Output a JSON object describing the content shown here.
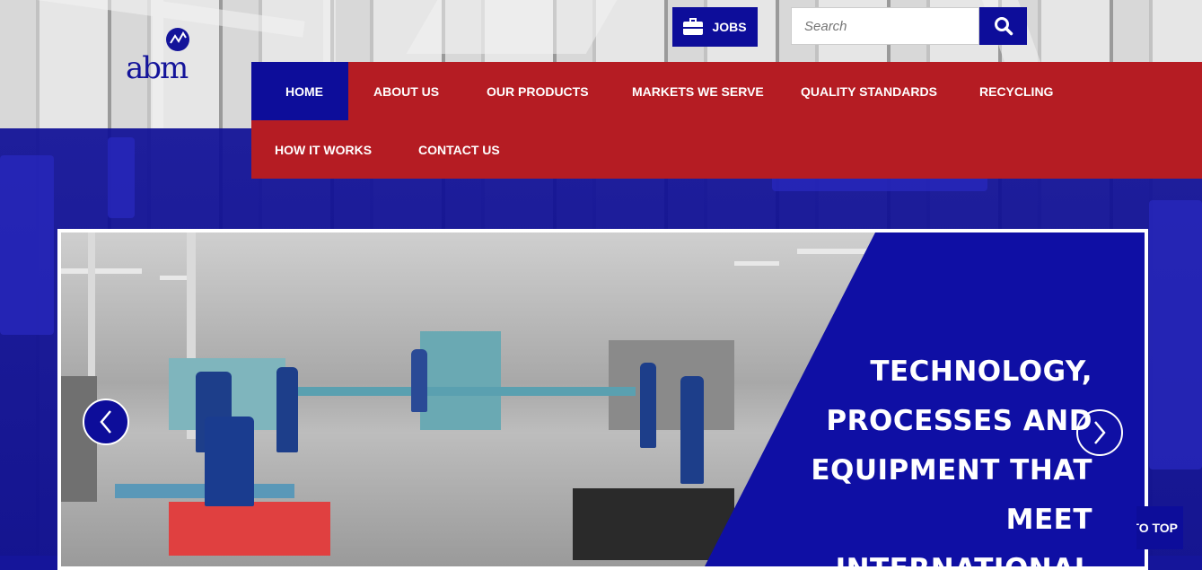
{
  "brand": {
    "logo_text": "abm",
    "colors": {
      "blue": "#0d0d9a",
      "red": "#b51c23",
      "white": "#ffffff"
    }
  },
  "header": {
    "jobs_label": "JOBS",
    "jobs_icon": "briefcase-icon",
    "search": {
      "placeholder": "Search",
      "value": "",
      "icon": "search-icon"
    }
  },
  "nav": {
    "items": [
      {
        "label": "HOME",
        "active": true
      },
      {
        "label": "ABOUT US",
        "active": false
      },
      {
        "label": "OUR PRODUCTS",
        "active": false
      },
      {
        "label": "MARKETS WE SERVE",
        "active": false
      },
      {
        "label": "QUALITY STANDARDS",
        "active": false
      },
      {
        "label": "RECYCLING",
        "active": false
      },
      {
        "label": "HOW IT WORKS",
        "active": false
      },
      {
        "label": "CONTACT US",
        "active": false
      }
    ]
  },
  "slider": {
    "headline_lines": [
      "TECHNOLOGY,",
      "PROCESSES AND",
      "EQUIPMENT THAT",
      "MEET",
      "INTERNATIONAL"
    ],
    "prev_icon": "chevron-left-icon",
    "next_icon": "chevron-right-icon"
  },
  "back_to_top_label": "BACK TO TOP"
}
